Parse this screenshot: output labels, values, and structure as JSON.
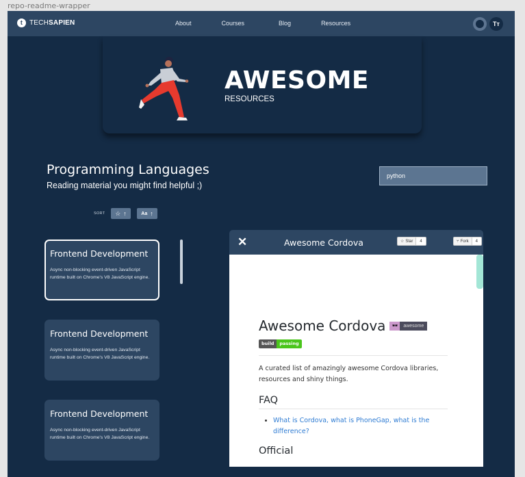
{
  "frame_label": "repo-readme-wrapper",
  "nav": {
    "logo_prefix": "TECH",
    "logo_bold": "SAPIEN",
    "logo_mark": "t",
    "links": [
      "About",
      "Courses",
      "Blog",
      "Resources"
    ],
    "font_toggle": "Tт"
  },
  "hero": {
    "title": "AWESOME",
    "subtitle": "RESOURCES"
  },
  "section": {
    "title": "Programming Languages",
    "subtitle": "Reading material you might find helpful ;)"
  },
  "search": {
    "value": "python"
  },
  "sort": {
    "label": "SORT",
    "star_glyph": "☆",
    "arrow": "↑",
    "alpha_glyph": "Aa"
  },
  "cards": [
    {
      "title": "Frontend Development",
      "description": "Async non-blocking event-driven JavaScript runtime built on Chrome's V8 JavaScript engine."
    },
    {
      "title": "Frontend Development",
      "description": "Async non-blocking event-driven JavaScript runtime built on Chrome's V8 JavaScript engine."
    },
    {
      "title": "Frontend Development",
      "description": "Async non-blocking event-driven JavaScript runtime built on Chrome's V8 JavaScript engine."
    }
  ],
  "readme": {
    "close_glyph": "✕",
    "title": "Awesome Cordova",
    "star_label": "Star",
    "star_count": "4",
    "fork_label": "Fork",
    "fork_count": "4",
    "h1": "Awesome Cordova",
    "awesome_badge_glyph": "🕶",
    "awesome_badge_text": "awesome",
    "build_badge_left": "build",
    "build_badge_right": "passing",
    "intro": "A curated list of amazingly awesome Cordova libraries, resources and shiny things.",
    "faq_heading": "FAQ",
    "faq_link": "What is Cordova, what is PhoneGap, what is the difference?",
    "official_heading": "Official"
  },
  "colors": {
    "background": "#142b45",
    "surface": "#2d4662",
    "accent_scroll": "#a3e6d6",
    "link": "#2f7cd3",
    "badge_green": "#4ac51c"
  }
}
